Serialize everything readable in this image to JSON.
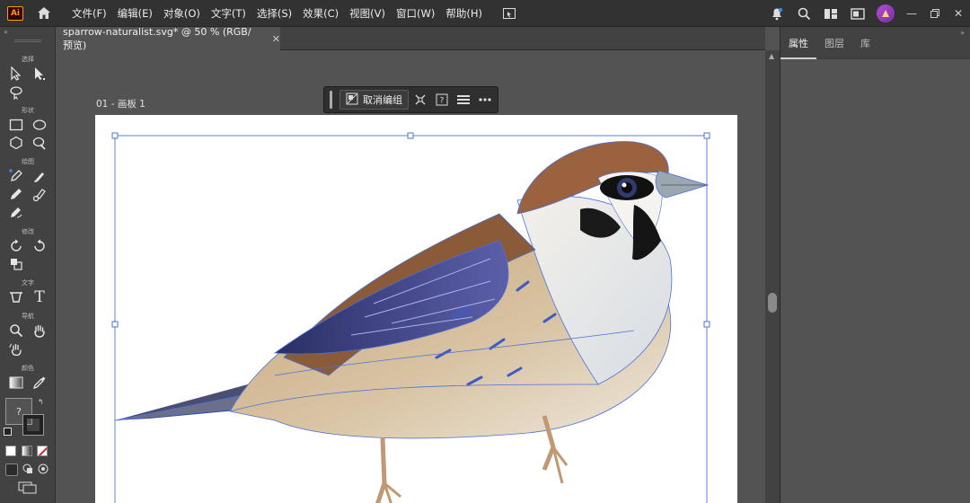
{
  "app": {
    "logo_text": "Ai"
  },
  "menubar": {
    "items": [
      "文件(F)",
      "编辑(E)",
      "对象(O)",
      "文字(T)",
      "选择(S)",
      "效果(C)",
      "视图(V)",
      "窗口(W)",
      "帮助(H)"
    ]
  },
  "document": {
    "tab_title": "sparrow-naturalist.svg* @ 50 % (RGB/预览)",
    "artboard_name": "01 - 画板 1"
  },
  "context_toolbar": {
    "ungroup_label": "取消编组"
  },
  "toolbar": {
    "sections": {
      "select": "选择",
      "shape": "形状",
      "draw": "绘图",
      "modify": "修改",
      "type": "文字",
      "navigate": "导航",
      "color": "颜色"
    },
    "type_tool_glyph": "T",
    "fill_placeholder": "?"
  },
  "right_panel": {
    "tabs": [
      "属性",
      "图层",
      "库"
    ],
    "active_tab": "属性"
  },
  "colors": {
    "accent": "#ff9a00",
    "selection": "#4a73d9",
    "bg_dark": "#323232",
    "canvas": "#535353"
  }
}
